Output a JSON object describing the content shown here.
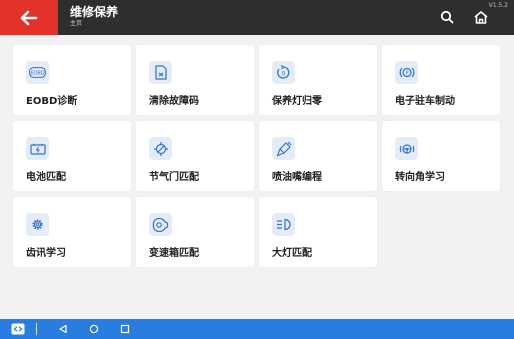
{
  "header": {
    "title": "维修保养",
    "subtitle": "主页",
    "version": "V1.5.2"
  },
  "functions": [
    {
      "label": "EOBD诊断",
      "icon": "eobd-icon"
    },
    {
      "label": "清除故障码",
      "icon": "clear-dtc-icon"
    },
    {
      "label": "保养灯归零",
      "icon": "service-reset-icon"
    },
    {
      "label": "电子驻车制动",
      "icon": "epb-icon"
    },
    {
      "label": "电池匹配",
      "icon": "battery-icon"
    },
    {
      "label": "节气门匹配",
      "icon": "throttle-icon"
    },
    {
      "label": "喷油嘴编程",
      "icon": "injector-icon"
    },
    {
      "label": "转向角学习",
      "icon": "steering-icon"
    },
    {
      "label": "齿讯学习",
      "icon": "gear-icon"
    },
    {
      "label": "变速箱匹配",
      "icon": "transmission-icon"
    },
    {
      "label": "大灯匹配",
      "icon": "headlight-icon"
    }
  ],
  "icons": {
    "eobd_text": "EOBD"
  },
  "colors": {
    "accent_red": "#e3322b",
    "header_bg": "#2e2e2e",
    "icon_blue": "#2f6fd8",
    "icon_bg": "#e4ecf8",
    "nav_blue": "#2a7de0"
  }
}
